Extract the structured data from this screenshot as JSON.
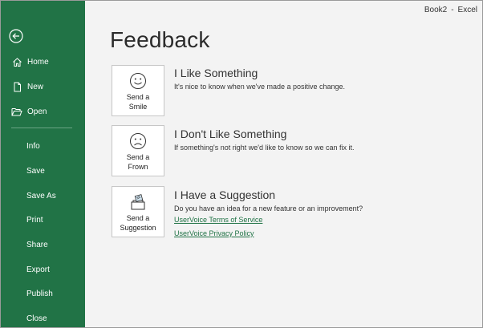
{
  "titlebar": {
    "doc": "Book2",
    "sep": "-",
    "app": "Excel"
  },
  "sidebar": {
    "items": [
      {
        "label": "Home"
      },
      {
        "label": "New"
      },
      {
        "label": "Open"
      },
      {
        "label": "Info"
      },
      {
        "label": "Save"
      },
      {
        "label": "Save As"
      },
      {
        "label": "Print"
      },
      {
        "label": "Share"
      },
      {
        "label": "Export"
      },
      {
        "label": "Publish"
      },
      {
        "label": "Close"
      }
    ]
  },
  "main": {
    "title": "Feedback",
    "options": [
      {
        "button_line1": "Send a",
        "button_line2": "Smile",
        "title": "I Like Something",
        "desc": "It's nice to know when we've made a positive change."
      },
      {
        "button_line1": "Send a",
        "button_line2": "Frown",
        "title": "I Don't Like Something",
        "desc": "If something's not right we'd like to know so we can fix it."
      },
      {
        "button_line1": "Send a",
        "button_line2": "Suggestion",
        "title": "I Have a Suggestion",
        "desc": "Do you have an idea for a new feature or an improvement?"
      }
    ],
    "links": [
      {
        "label": "UserVoice Terms of Service"
      },
      {
        "label": "UserVoice Privacy Policy"
      }
    ]
  },
  "colors": {
    "sidebar": "#217346",
    "link": "#217346"
  }
}
